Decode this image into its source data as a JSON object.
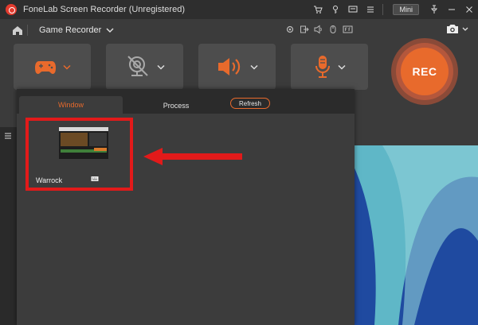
{
  "app": {
    "title": "FoneLab Screen Recorder (Unregistered)",
    "mini_label": "Mini"
  },
  "header": {
    "mode_label": "Game Recorder"
  },
  "rec": {
    "label": "REC"
  },
  "panel": {
    "tabs": [
      "Window",
      "Process"
    ],
    "active_tab": "Window",
    "refresh_label": "Refresh",
    "windows": [
      {
        "label": "Warrock"
      }
    ]
  },
  "colors": {
    "accent": "#e86a2c",
    "highlight": "#e21a1a",
    "preview_blue": "#1f4aa0",
    "preview_teal": "#5fb7c7"
  },
  "icons": {
    "titlebar": [
      "cart-icon",
      "key-icon",
      "feedback-icon",
      "menu-icon",
      "pin-icon",
      "minimize-icon",
      "close-icon"
    ],
    "tools": [
      "settings-icon",
      "export-icon",
      "speaker-icon",
      "mouse-icon",
      "fps-icon"
    ],
    "cards": [
      "gamepad-icon",
      "webcam-off-icon",
      "speaker-icon",
      "microphone-icon"
    ]
  }
}
